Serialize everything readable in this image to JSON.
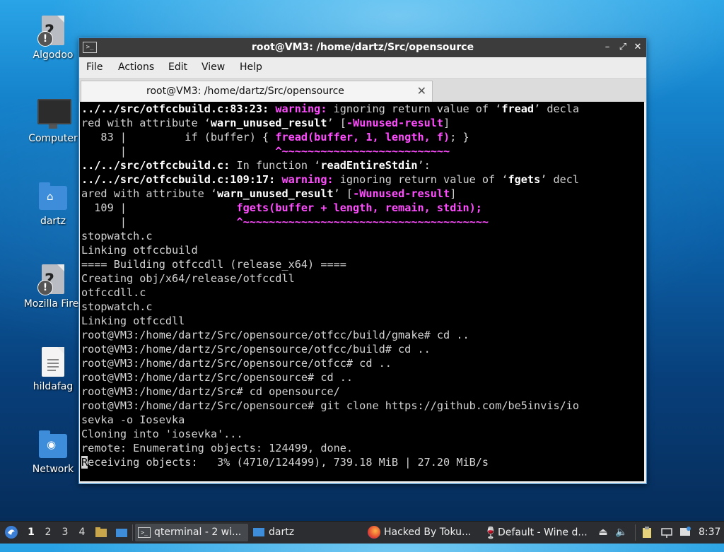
{
  "desktop": {
    "icons": [
      {
        "label": "Algodoo",
        "icon": "unknown-file-icon"
      },
      {
        "label": "Computer",
        "icon": "computer-icon"
      },
      {
        "label": "dartz",
        "icon": "home-folder-icon"
      },
      {
        "label": "Mozilla Firef",
        "icon": "unknown-file-icon"
      },
      {
        "label": "hildafag",
        "icon": "text-file-icon"
      },
      {
        "label": "Network",
        "icon": "network-folder-icon"
      }
    ]
  },
  "window": {
    "title": "root@VM3: /home/dartz/Src/opensource",
    "menu": [
      "File",
      "Actions",
      "Edit",
      "View",
      "Help"
    ],
    "tab_label": "root@VM3: /home/dartz/Src/opensource"
  },
  "terminal": {
    "lines": [
      [
        {
          "t": "../../src/otfccbuild.c:83:23: ",
          "c": "b"
        },
        {
          "t": "warning: ",
          "c": "m"
        },
        {
          "t": "ignoring return value of ‘"
        },
        {
          "t": "fread",
          "c": "b"
        },
        {
          "t": "’ decla"
        }
      ],
      [
        {
          "t": "red with attribute ‘"
        },
        {
          "t": "warn_unused_result",
          "c": "b"
        },
        {
          "t": "’ ["
        },
        {
          "t": "-Wunused-result",
          "c": "m"
        },
        {
          "t": "]"
        }
      ],
      [
        {
          "t": "   83 |         if (buffer) { "
        },
        {
          "t": "fread(buffer, 1, length, f)",
          "c": "m"
        },
        {
          "t": "; }"
        }
      ],
      [
        {
          "t": "      |                       "
        },
        {
          "t": "^~~~~~~~~~~~~~~~~~~~~~~~~~~",
          "c": "m"
        }
      ],
      [
        {
          "t": "../../src/otfccbuild.c:",
          "c": "b"
        },
        {
          "t": " In function ‘"
        },
        {
          "t": "readEntireStdin",
          "c": "b"
        },
        {
          "t": "’:"
        }
      ],
      [
        {
          "t": "../../src/otfccbuild.c:109:17: ",
          "c": "b"
        },
        {
          "t": "warning: ",
          "c": "m"
        },
        {
          "t": "ignoring return value of ‘"
        },
        {
          "t": "fgets",
          "c": "b"
        },
        {
          "t": "’ decl"
        }
      ],
      [
        {
          "t": "ared with attribute ‘"
        },
        {
          "t": "warn_unused_result",
          "c": "b"
        },
        {
          "t": "’ ["
        },
        {
          "t": "-Wunused-result",
          "c": "m"
        },
        {
          "t": "]"
        }
      ],
      [
        {
          "t": "  109 |                 "
        },
        {
          "t": "fgets(buffer + length, remain, stdin);",
          "c": "m"
        }
      ],
      [
        {
          "t": "      |                 "
        },
        {
          "t": "^~~~~~~~~~~~~~~~~~~~~~~~~~~~~~~~~~~~~~~",
          "c": "m"
        }
      ],
      [
        {
          "t": "stopwatch.c"
        }
      ],
      [
        {
          "t": "Linking otfccbuild"
        }
      ],
      [
        {
          "t": "==== Building otfccdll (release_x64) ===="
        }
      ],
      [
        {
          "t": "Creating obj/x64/release/otfccdll"
        }
      ],
      [
        {
          "t": "otfccdll.c"
        }
      ],
      [
        {
          "t": "stopwatch.c"
        }
      ],
      [
        {
          "t": "Linking otfccdll"
        }
      ],
      [
        {
          "t": "root@VM3:/home/dartz/Src/opensource/otfcc/build/gmake# cd .."
        }
      ],
      [
        {
          "t": "root@VM3:/home/dartz/Src/opensource/otfcc/build# cd .."
        }
      ],
      [
        {
          "t": "root@VM3:/home/dartz/Src/opensource/otfcc# cd .."
        }
      ],
      [
        {
          "t": "root@VM3:/home/dartz/Src/opensource# cd .."
        }
      ],
      [
        {
          "t": "root@VM3:/home/dartz/Src# cd opensource/"
        }
      ],
      [
        {
          "t": "root@VM3:/home/dartz/Src/opensource# git clone https://github.com/be5invis/io"
        }
      ],
      [
        {
          "t": "sevka -o Iosevka"
        }
      ],
      [
        {
          "t": "Cloning into 'iosevka'..."
        }
      ],
      [
        {
          "t": "remote: Enumerating objects: 124499, done."
        }
      ],
      [
        {
          "t": "R",
          "c": "cursor"
        },
        {
          "t": "eceiving objects:   3% (4710/124499), 739.18 MiB | 27.20 MiB/s"
        }
      ]
    ]
  },
  "taskbar": {
    "workspaces": [
      "1",
      "2",
      "3",
      "4"
    ],
    "active_workspace": "1",
    "tasks": [
      {
        "label": "qterminal - 2 wi...",
        "icon": "terminal-icon",
        "active": true
      },
      {
        "label": "dartz",
        "icon": "folder-icon",
        "active": false
      },
      {
        "label": "Hacked By Toku...",
        "icon": "firefox-icon",
        "active": false
      },
      {
        "label": "Default - Wine d...",
        "icon": "wine-icon",
        "active": false
      }
    ],
    "clock": "8:37"
  }
}
